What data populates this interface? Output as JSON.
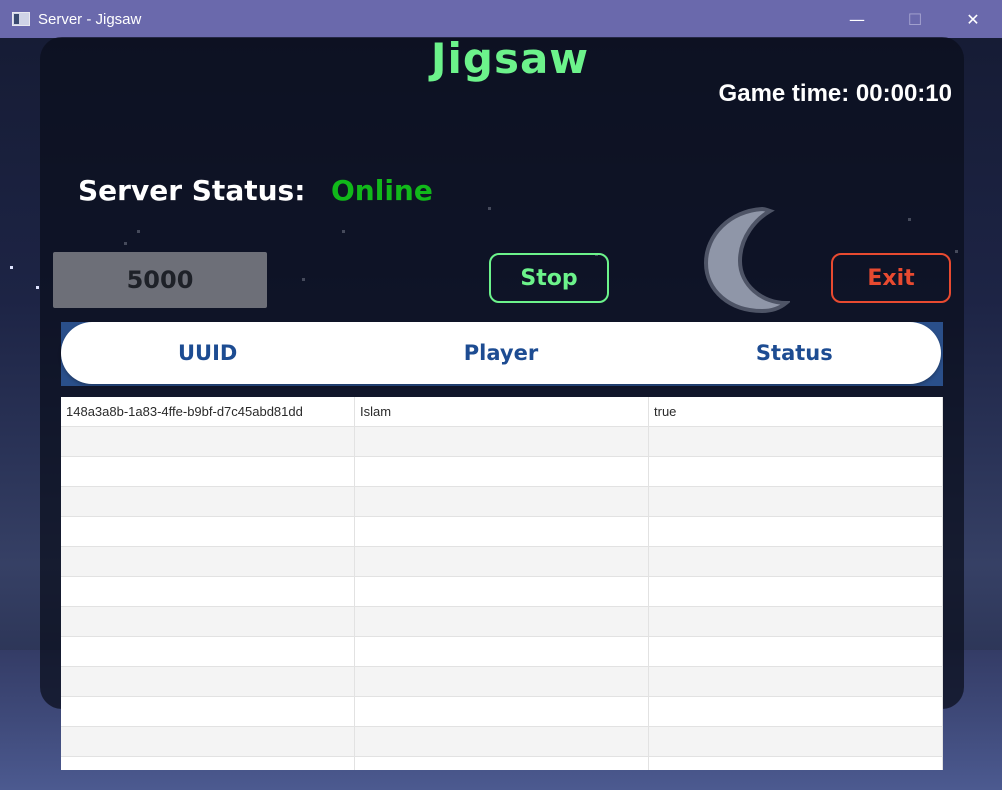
{
  "window": {
    "title": "Server - Jigsaw",
    "minimize_glyph": "—",
    "maximize_glyph": "☐",
    "close_glyph": "✕"
  },
  "app": {
    "title": "Jigsaw",
    "game_time": "Game time: 00:00:10",
    "server_status_label": "Server Status:",
    "server_status_value": "Online",
    "port_value": "5000",
    "stop_label": "Stop",
    "exit_label": "Exit"
  },
  "table": {
    "headers": [
      "UUID",
      "Player",
      "Status"
    ],
    "rows": [
      [
        "148a3a8b-1a83-4ffe-b9bf-d7c45abd81dd",
        "Islam",
        "true"
      ]
    ]
  },
  "colors": {
    "accent_green": "#6cf38b",
    "online_green": "#11b81a",
    "exit_red": "#e84a30",
    "header_blue": "#1d4c92",
    "titlebar": "#6a69ac"
  }
}
